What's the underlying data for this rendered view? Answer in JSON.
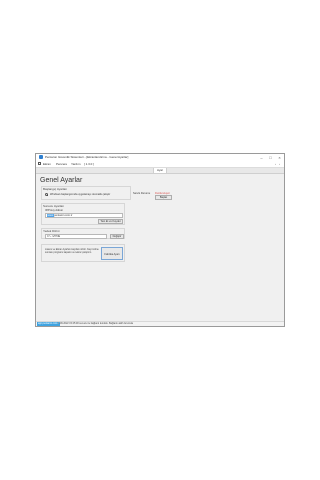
{
  "window": {
    "title": "Pentaron Güvenlik Sistemleri - [Ekranlandırma - Genel Ayarlar]",
    "minimize": "–",
    "maximize": "□",
    "close": "×"
  },
  "menu": {
    "items": [
      "Ekran",
      "Pencere",
      "Yardım",
      "[ 1.3.0 ]"
    ],
    "nav": "‹ ›"
  },
  "tabs": [
    {
      "label": "Ayar"
    }
  ],
  "page": {
    "title": "Genel Ayarlar"
  },
  "form": {
    "startup_group_label": "Başlangıç Ayarları",
    "startup_option": "Windows başlangıcında uygulamayı otomatik çalıştır",
    "server_group_label": "Sunucu Ayarları",
    "server_address_label": "IP/Proxy Adresi",
    "server_address_selected": "www.",
    "server_address_rest": "pentaron.com.tr",
    "test_button": "Test Et ve Kaydet",
    "backup_label": "Yedek Dizini",
    "backup_path": "C:\\...\\ZYNE",
    "backup_button": "Değiştir",
    "info_text": "Lisans ve Ekran Ayarları kayıtları silinir. Kayıt silme sonrası programı kapatın ve tekrar çalıştırın.",
    "reset_button": "Fabrika Ayarı",
    "service_status_label": "Servis Durumu",
    "service_status_value": "Durduruluyor",
    "start_button": "Başlat"
  },
  "status": {
    "url": "app.pentaron.com.tr",
    "text": "1.06.2022 15:25:48 sunucu ile bağlantı kuruldu. Bağlantı aktif durumda"
  },
  "colors": {
    "accent": "#3fa3e0",
    "status_warning": "#d9534f"
  },
  "icons": {
    "app": "app-icon",
    "menu": "menu-icon"
  }
}
